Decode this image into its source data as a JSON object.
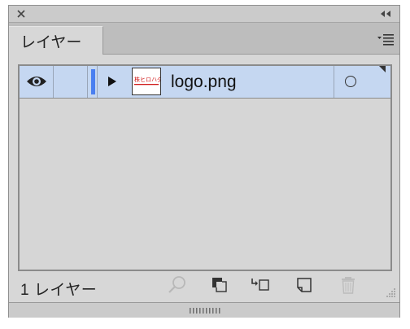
{
  "panel": {
    "tab_label": "レイヤー",
    "layers": [
      {
        "name": "logo.png",
        "visible": true,
        "expanded": false,
        "thumbnail_text": "株ヒロハダ"
      }
    ],
    "footer": {
      "count_label": "1 レイヤー"
    },
    "colors": {
      "selection": "#c5d7f1",
      "layer_color": "#4a7ff0",
      "panel_bg": "#d7d7d7"
    },
    "icons": {
      "close": "close-icon",
      "collapse": "double-chevron-left-icon",
      "menu": "panel-menu-icon",
      "visibility": "eye-icon",
      "expand": "disclosure-triangle-icon",
      "target": "target-circle-icon",
      "locate": "search-icon",
      "mask": "clipping-mask-icon",
      "sublayer": "new-sublayer-icon",
      "newlayer": "new-layer-icon",
      "delete": "trash-icon"
    }
  }
}
